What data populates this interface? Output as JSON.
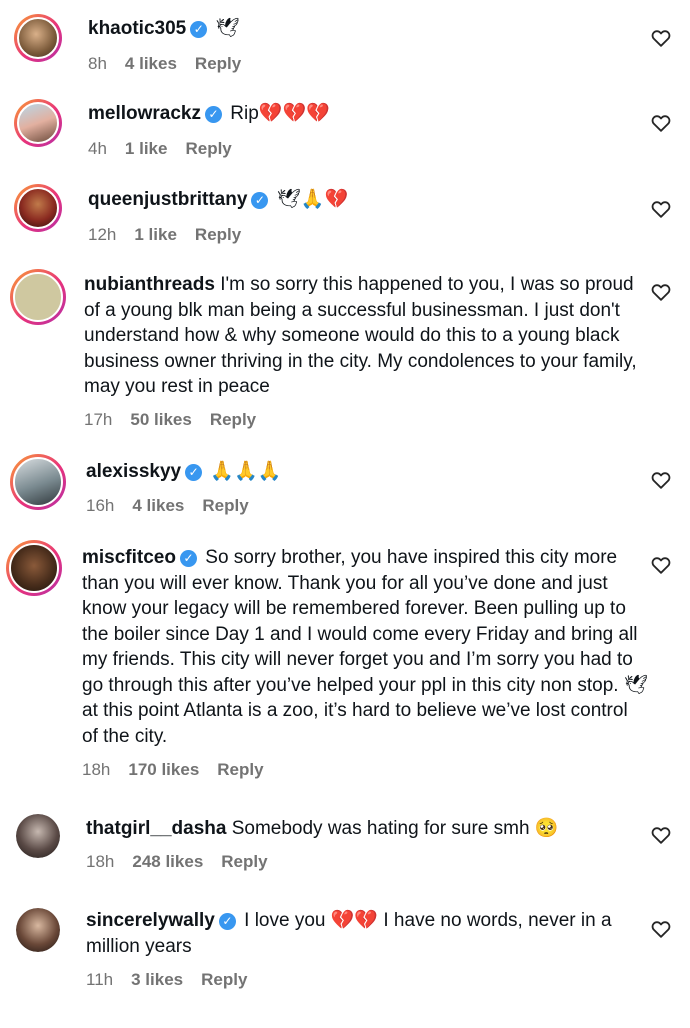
{
  "comments": [
    {
      "username": "khaotic305",
      "verified": true,
      "text": "",
      "emoji": "🕊",
      "time": "8h",
      "likes": "4 likes",
      "reply": "Reply"
    },
    {
      "username": "mellowrackz",
      "verified": true,
      "text": "Rip",
      "emoji": "💔💔💔",
      "time": "4h",
      "likes": "1 like",
      "reply": "Reply"
    },
    {
      "username": "queenjustbrittany",
      "verified": true,
      "text": "",
      "emoji": "🕊🙏💔",
      "time": "12h",
      "likes": "1 like",
      "reply": "Reply"
    },
    {
      "username": "nubianthreads",
      "verified": false,
      "text": "I'm so sorry this happened to you, I was so proud of a young blk man being a successful businessman. I just don't understand how & why someone would do this to a young black business owner thriving in the city. My condolences to your family, may you rest in peace",
      "emoji": "",
      "time": "17h",
      "likes": "50 likes",
      "reply": "Reply"
    },
    {
      "username": "alexisskyy",
      "verified": true,
      "text": "",
      "emoji": "🙏🙏🙏",
      "time": "16h",
      "likes": "4 likes",
      "reply": "Reply"
    },
    {
      "username": "miscfitceo",
      "verified": true,
      "text": "So sorry brother, you have inspired this city more than you will ever know. Thank you for all you’ve done and just know your legacy will be remembered forever. Been pulling up to the boiler since Day 1 and I would come every Friday and bring all my friends. This city will never forget you and I’m sorry you had to go through this after you’ve helped your ppl in this city non stop. 🕊 at this point Atlanta is a zoo, it’s hard to believe we’ve lost control of the city.",
      "emoji": "",
      "time": "18h",
      "likes": "170 likes",
      "reply": "Reply"
    },
    {
      "username": "thatgirl__dasha",
      "verified": false,
      "text": "Somebody was hating for sure smh",
      "emoji": "🥺",
      "time": "18h",
      "likes": "248 likes",
      "reply": "Reply"
    },
    {
      "username": "sincerelywally",
      "verified": true,
      "text": "I love you",
      "emoji": "💔💔",
      "text2": "I have no words, never in a million years",
      "time": "11h",
      "likes": "3 likes",
      "reply": "Reply"
    }
  ],
  "icons": {
    "like": "heart-outline-icon",
    "verified": "verified-badge-icon"
  },
  "colors": {
    "verified": "#3897f0",
    "meta": "#737373",
    "ring_start": "#f9a033",
    "ring_end": "#b52fa8"
  }
}
